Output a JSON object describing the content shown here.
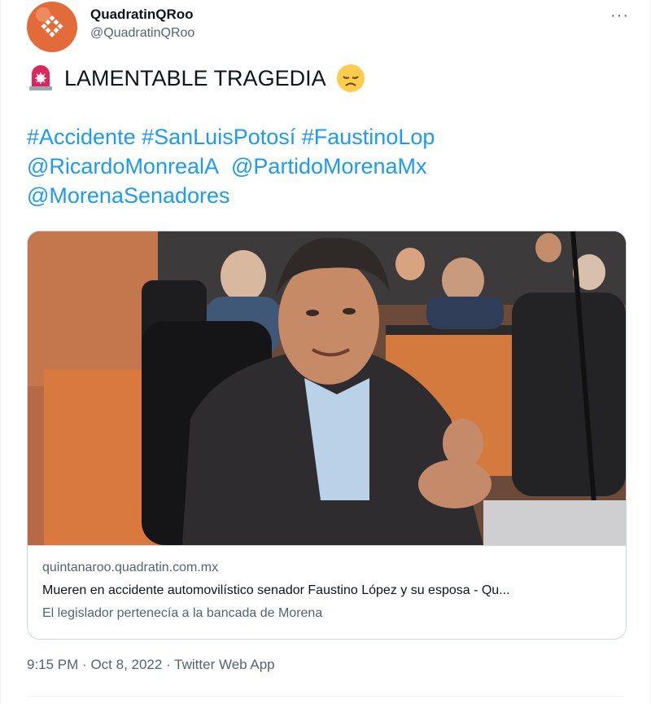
{
  "author": {
    "display_name": "QuadratinQRoo",
    "handle": "@QuadratinQRoo"
  },
  "menu_icon": "more-dots-icon",
  "tweet": {
    "headline": "LAMENTABLE TRAGEDIA",
    "hashtags": [
      "#Accidente",
      "#SanLuisPotosí",
      "#FaustinoLop"
    ],
    "mentions_line1": [
      "@RicardoMonrealA",
      "@PartidoMorenaMx"
    ],
    "mentions_line2": [
      "@MorenaSenadores"
    ],
    "emoji_start": "siren-icon",
    "emoji_end": "disappointed-face-icon"
  },
  "card": {
    "domain": "quintanaroo.quadratin.com.mx",
    "title": "Mueren en accidente automovilístico senador Faustino López y su esposa - Qu...",
    "description": "El legislador pertenecía a la bancada de Morena"
  },
  "footer": {
    "time": "9:15 PM",
    "date": "Oct 8, 2022",
    "source": "Twitter Web App",
    "separator": "·"
  },
  "colors": {
    "link": "#1d9bf0",
    "secondary_text": "#536471",
    "avatar_bg": "#e36b3a"
  }
}
